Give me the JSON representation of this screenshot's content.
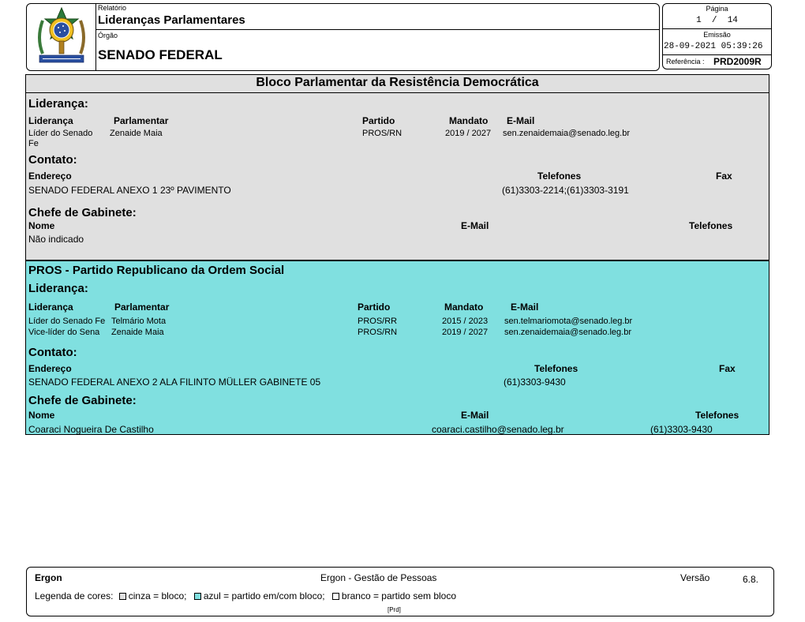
{
  "header": {
    "relatorio_label": "Relatório",
    "relatorio_value": "Lideranças Parlamentares",
    "orgao_label": "Órgão",
    "orgao_value": "SENADO FEDERAL",
    "pagina_label": "Página",
    "pagina_value": "1  /  14",
    "emissao_label": "Emissão",
    "emissao_value": "28-09-2021 05:39:26",
    "referencia_label": "Referência :",
    "referencia_value": "PRD2009R",
    "logo": "brazil-coat-of-arms"
  },
  "blocks": [
    {
      "title": "Bloco Parlamentar da Resistência Democrática",
      "color": "#e0e0e0",
      "lideranca_title": "Liderança:",
      "lideranca_headers": [
        "Liderança",
        "Parlamentar",
        "Partido",
        "Mandato",
        "E-Mail"
      ],
      "lideranca_rows": [
        [
          "Líder do Senado Fe",
          "Zenaide Maia",
          "PROS/RN",
          "2019 / 2027",
          "sen.zenaidemaia@senado.leg.br"
        ]
      ],
      "contato_title": "Contato:",
      "contato_headers": [
        "Endereço",
        "Telefones",
        "Fax"
      ],
      "contato_values": [
        "SENADO FEDERAL ANEXO 1  23º PAVIMENTO",
        "(61)3303-2214;(61)3303-3191",
        ""
      ],
      "chefe_title": "Chefe de Gabinete:",
      "chefe_headers": [
        "Nome",
        "E-Mail",
        "Telefones"
      ],
      "chefe_values": [
        "Não indicado",
        "",
        ""
      ]
    },
    {
      "title": "PROS - Partido Republicano da Ordem Social",
      "color": "#80e0e0",
      "lideranca_title": "Liderança:",
      "lideranca_headers": [
        "Liderança",
        "Parlamentar",
        "Partido",
        "Mandato",
        "E-Mail"
      ],
      "lideranca_rows": [
        [
          "Líder do Senado Fe",
          "Telmário Mota",
          "PROS/RR",
          "2015 / 2023",
          "sen.telmariomota@senado.leg.br"
        ],
        [
          "Vice-líder do Sena",
          "Zenaide Maia",
          "PROS/RN",
          "2019 / 2027",
          "sen.zenaidemaia@senado.leg.br"
        ]
      ],
      "contato_title": "Contato:",
      "contato_headers": [
        "Endereço",
        "Telefones",
        "Fax"
      ],
      "contato_values": [
        "SENADO FEDERAL ANEXO 2   ALA FILINTO MÜLLER GABINETE 05",
        "(61)3303-9430",
        ""
      ],
      "chefe_title": "Chefe de Gabinete:",
      "chefe_headers": [
        "Nome",
        "E-Mail",
        "Telefones"
      ],
      "chefe_values": [
        "Coaraci Nogueira De Castilho",
        "coaraci.castilho@senado.leg.br",
        "(61)3303-9430"
      ]
    }
  ],
  "footer": {
    "app": "Ergon",
    "app_full": "Ergon - Gestão de Pessoas",
    "versao_label": "Versão",
    "versao_value": "6.8.",
    "legenda_label": "Legenda de cores:",
    "legend_items": [
      {
        "color": "#e0e0e0",
        "text": "cinza = bloco;"
      },
      {
        "color": "#80e0e0",
        "text": "azul = partido em/com bloco;"
      },
      {
        "color": "#ffffff",
        "text": "branco = partido sem bloco"
      }
    ],
    "code": "[Prd]"
  }
}
